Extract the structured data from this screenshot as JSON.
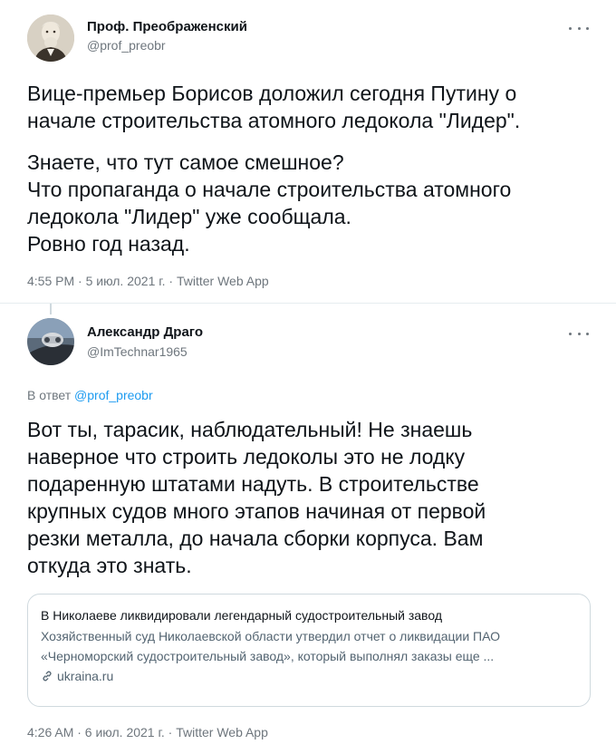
{
  "tweet1": {
    "author_name": "Проф. Преображенский",
    "author_handle": "@prof_preobr",
    "paragraph1": "Вице-премьер Борисов доложил сегодня Путину о\nначале строительства атомного ледокола \"Лидер\".",
    "paragraph2": "Знаете, что тут самое смешное?\nЧто пропаганда о начале строительства атомного\nледокола \"Лидер\" уже сообщала.\nРовно год назад.",
    "meta": "4:55 PM · 5 июл. 2021 г. · Twitter Web App"
  },
  "tweet2": {
    "author_name": "Александр Драго",
    "author_handle": "@ImTechnar1965",
    "reply_prefix": "В ответ ",
    "reply_handle": "@prof_preobr",
    "text": "Вот ты, тарасик, наблюдательный! Не знаешь\nнаверное что строить ледоколы это не лодку\nподаренную штатами надуть. В строительстве\nкрупных судов много этапов начиная от первой\nрезки металла, до начала сборки корпуса. Вам\nоткуда это знать.",
    "card": {
      "title": "В Николаеве ликвидировали легендарный судостроительный завод",
      "description": "Хозяйственный суд Николаевской области утвердил отчет о ликвидации ПАО «Черноморский судостроительный завод», который выполнял заказы еще ...",
      "domain": "ukraina.ru"
    },
    "meta": "4:26 AM · 6 июл. 2021 г. · Twitter Web App"
  },
  "colors": {
    "text": "#0f1419",
    "secondary": "#6e767d",
    "link": "#1d9bf0",
    "border": "#cfd9de"
  }
}
